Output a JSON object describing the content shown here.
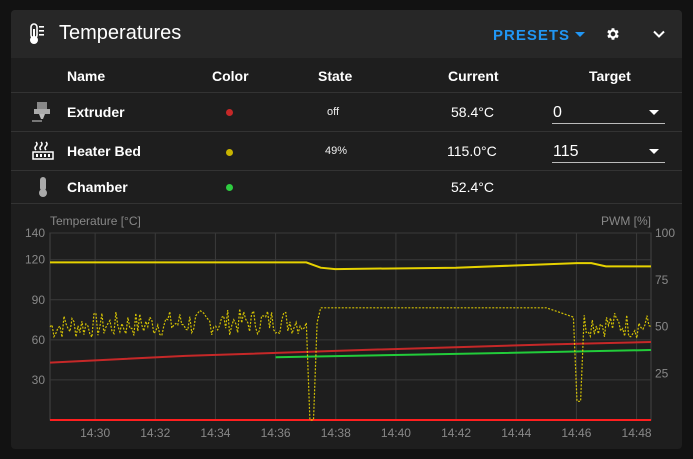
{
  "header": {
    "title": "Temperatures",
    "presets_label": "PRESETS"
  },
  "columns": {
    "name": "Name",
    "color": "Color",
    "state": "State",
    "current": "Current",
    "target": "Target"
  },
  "rows": [
    {
      "name": "Extruder",
      "icon": "extruder-icon",
      "color": "#c62828",
      "state": "off",
      "current": "58.4°C",
      "target": "0"
    },
    {
      "name": "Heater Bed",
      "icon": "heater-bed-icon",
      "color": "#c8b400",
      "state": "49%",
      "current": "115.0°C",
      "target": "115"
    },
    {
      "name": "Chamber",
      "icon": "thermometer-icon",
      "color": "#2ecc40",
      "state": "",
      "current": "52.4°C",
      "target": ""
    }
  ],
  "colors": {
    "accent": "#2196f3",
    "extruder": "#c62828",
    "extruder_target": "#ff1f1f",
    "heater_bed": "#e6d200",
    "chamber": "#22cc3a"
  },
  "chart_data": {
    "type": "line",
    "ylabel": "Temperature [°C]",
    "y2label": "PWM [%]",
    "ylim": [
      0,
      140
    ],
    "y2lim": [
      0,
      100
    ],
    "yticks": [
      "140",
      "120",
      "90",
      "60",
      "30"
    ],
    "y2ticks": [
      "100",
      "75",
      "50",
      "25"
    ],
    "xticks": [
      "14:30",
      "14:32",
      "14:34",
      "14:36",
      "14:38",
      "14:40",
      "14:42",
      "14:44",
      "14:46",
      "14:48"
    ],
    "series": [
      {
        "name": "Heater Bed",
        "axis": "y",
        "x": [
          14.475,
          14.5,
          14.6,
          14.617,
          14.625,
          14.633,
          14.7,
          14.767,
          14.775,
          14.783,
          14.808
        ],
        "y": [
          118,
          118,
          118,
          118,
          114,
          113,
          114,
          117.5,
          117.5,
          115,
          115
        ]
      },
      {
        "name": "Extruder",
        "axis": "y",
        "x": [
          14.475,
          14.55,
          14.65,
          14.75,
          14.808
        ],
        "y": [
          43,
          48,
          52.5,
          56.5,
          58.4
        ]
      },
      {
        "name": "Chamber",
        "axis": "y",
        "x": [
          14.6,
          14.7,
          14.808
        ],
        "y": [
          47,
          49.5,
          52.4
        ]
      },
      {
        "name": "Extruder Target",
        "axis": "y",
        "x": [
          14.475,
          14.808
        ],
        "y": [
          0,
          0
        ]
      },
      {
        "name": "Heater Bed PWM",
        "axis": "y2",
        "x": [
          14.475,
          14.6,
          14.617,
          14.619,
          14.621,
          14.623,
          14.625,
          14.75,
          14.765,
          14.767,
          14.769,
          14.771,
          14.808
        ],
        "y": [
          50,
          53,
          52,
          0,
          0,
          52,
          60,
          60,
          55,
          10,
          10,
          52,
          50
        ]
      }
    ]
  }
}
